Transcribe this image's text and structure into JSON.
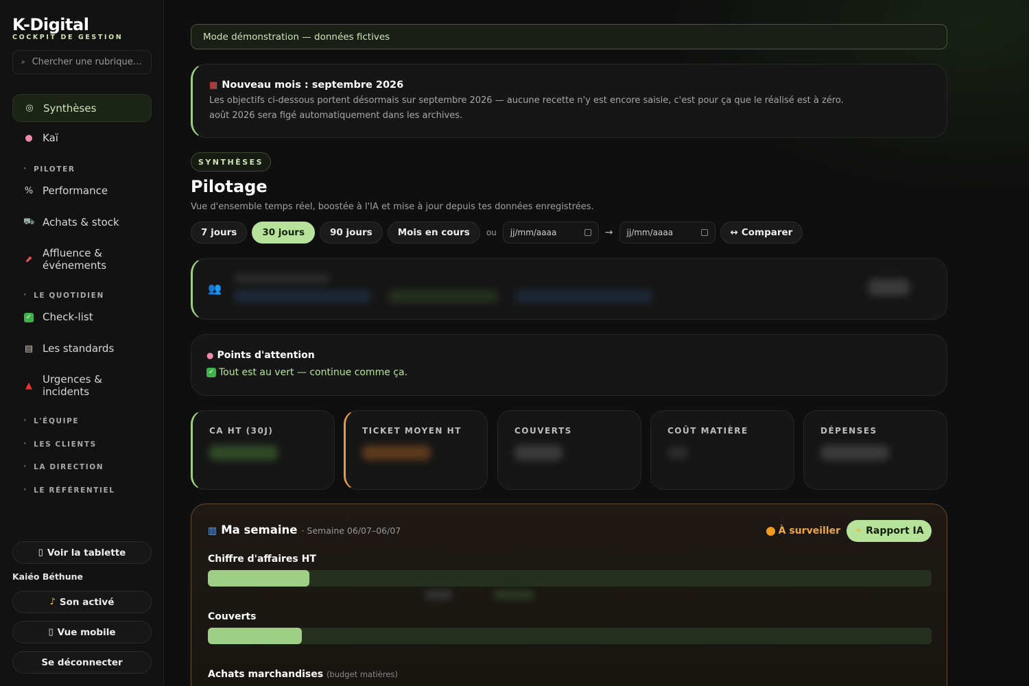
{
  "app": {
    "name": "K-Digital",
    "subtitle": "COCKPIT DE GESTION"
  },
  "search": {
    "placeholder": "Chercher une rubrique…"
  },
  "sidebar": {
    "items": [
      {
        "label": "Synthèses",
        "icon": "target-icon",
        "active": true
      },
      {
        "label": "Kaï",
        "icon": "brain-icon"
      },
      {
        "label": "Performance",
        "icon": "percent-icon"
      },
      {
        "label": "Achats & stock",
        "icon": "cart-icon"
      },
      {
        "label": "Affluence & événements",
        "icon": "chart-up-icon"
      },
      {
        "label": "Check-list",
        "icon": "checkbox-icon"
      },
      {
        "label": "Les standards",
        "icon": "clipboard-icon"
      },
      {
        "label": "Urgences & incidents",
        "icon": "siren-icon"
      }
    ],
    "sections": [
      "PILOTER",
      "LE QUOTIDIEN",
      "L'ÉQUIPE",
      "LES CLIENTS",
      "LA DIRECTION",
      "LE RÉFÉRENTIEL"
    ],
    "tablet_button": "Voir la tablette",
    "user_name": "Kaiéo Béthune",
    "sound_button": "Son activé",
    "mobile_button": "Vue mobile",
    "logout_button": "Se déconnecter"
  },
  "main": {
    "demo_banner": "Mode démonstration — données fictives",
    "new_month": {
      "title": "Nouveau mois : septembre 2026",
      "line1": "Les objectifs ci-dessous portent désormais sur septembre 2026 — aucune recette n'y est encore saisie, c'est pour ça que le réalisé est à zéro.",
      "line2": "août 2026 sera figé automatiquement dans les archives."
    },
    "section_pill": "SYNTHÈSES",
    "title": "Pilotage",
    "subtitle": "Vue d'ensemble temps réel, boostée à l'IA et mise à jour depuis tes données enregistrées.",
    "ranges": [
      "7 jours",
      "30 jours",
      "90 jours",
      "Mois en cours"
    ],
    "active_range": "30 jours",
    "or_label": "ou",
    "date_placeholder": "jj/mm/aaaa",
    "compare_button": "Comparer",
    "attention": {
      "title": "Points d'attention",
      "text": "Tout est au vert — continue comme ça."
    },
    "kpis": [
      "CA HT (30J)",
      "TICKET MOYEN HT",
      "COUVERTS",
      "COÛT MATIÈRE",
      "DÉPENSES"
    ],
    "week": {
      "title": "Ma semaine",
      "subtitle": "· Semaine 06/07–06/07",
      "status": "À surveiller",
      "report_button": "Rapport IA",
      "metrics": [
        {
          "label": "Chiffre d'affaires HT",
          "fill": 0.14
        },
        {
          "label": "Couverts",
          "fill": 0.13
        },
        {
          "label": "Achats marchandises",
          "note": "(budget matières)"
        }
      ]
    }
  },
  "colors": {
    "accent": "#b7e29a",
    "accent_border": "#9fcf85",
    "warning": "#f39a21",
    "background": "#0f0f0f"
  }
}
